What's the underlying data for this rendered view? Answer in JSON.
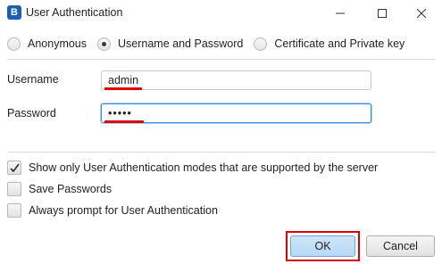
{
  "window": {
    "title": "User Authentication",
    "icon_letter": "B"
  },
  "auth_modes": [
    {
      "label": "Anonymous",
      "checked": false
    },
    {
      "label": "Username and Password",
      "checked": true
    },
    {
      "label": "Certificate and Private key",
      "checked": false
    }
  ],
  "fields": {
    "username_label": "Username",
    "username_value": "admin",
    "password_label": "Password",
    "password_value": "•••••"
  },
  "options": [
    {
      "label": "Show only User Authentication modes that are supported by the server",
      "checked": true
    },
    {
      "label": "Save Passwords",
      "checked": false
    },
    {
      "label": "Always prompt for User Authentication",
      "checked": false
    }
  ],
  "buttons": {
    "ok": "OK",
    "cancel": "Cancel"
  },
  "colors": {
    "annotation_red": "#e00000",
    "focus_blue": "#3b8edb",
    "ok_button": "#b7d8f5"
  }
}
